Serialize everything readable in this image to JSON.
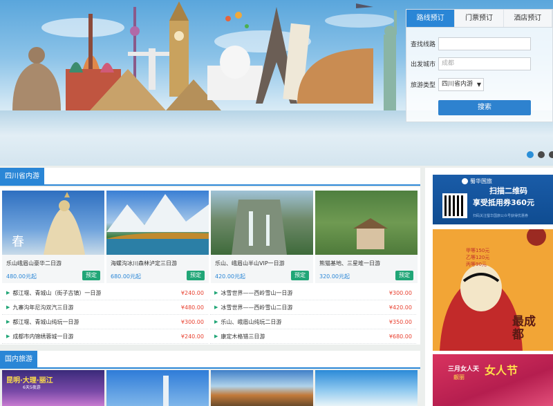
{
  "booking": {
    "tabs": [
      "路线预订",
      "门票预订",
      "酒店预订"
    ],
    "active_tab": 0,
    "route_label": "查找线路",
    "route_placeholder": "",
    "city_label": "出发城市",
    "city_placeholder": "成都",
    "type_label": "旅游类型",
    "type_value": "四川省内游",
    "search_label": "搜索"
  },
  "carousel": {
    "dot_count": 3,
    "active_dot": 0
  },
  "sections": [
    {
      "title": "四川省内游",
      "cards": [
        {
          "name": "乐山峨眉山豪华二日游",
          "price": "480.00元起",
          "book": "预定",
          "image_text": "春"
        },
        {
          "name": "海螺沟冰川森林泸定三日游",
          "price": "680.00元起",
          "book": "预定"
        },
        {
          "name": "乐山、峨眉山半山VIP一日游",
          "price": "420.00元起",
          "book": "预定"
        },
        {
          "name": "熊猫基地、三星堆一日游",
          "price": "320.00元起",
          "book": "预定"
        }
      ],
      "routes_left": [
        {
          "name": "都江堰、青城山（街子古镇）一日游",
          "price": "¥240.00"
        },
        {
          "name": "九寨沟年尼沟双汽三日游",
          "price": "¥480.00"
        },
        {
          "name": "都江堰、青城山纯玩一日游",
          "price": "¥300.00"
        },
        {
          "name": "成都市内锦绣蓉城一日游",
          "price": "¥240.00"
        }
      ],
      "routes_right": [
        {
          "name": "冰雪世界——西岭雪山一日游",
          "price": "¥300.00"
        },
        {
          "name": "冰雪世界——西岭雪山二日游",
          "price": "¥420.00"
        },
        {
          "name": "乐山、峨眉山纯玩二日游",
          "price": "¥350.00"
        },
        {
          "name": "康定木格错三日游",
          "price": "¥680.00"
        }
      ]
    },
    {
      "title": "国内旅游",
      "card_texts": [
        "昆明·大理·丽江",
        "6天5夜游"
      ]
    }
  ],
  "ads": {
    "ad1": {
      "brand": "蜀华国旅",
      "line1": "扫描二维码",
      "line2": "享受抵用券360元",
      "small": "扫码关注蜀华国旅公众号获得优惠券"
    },
    "ad2": {
      "line1": "甲等150元",
      "line2": "乙等120元",
      "line3": "丙等90元",
      "big": "最成都"
    },
    "ad3": {
      "text1": "三月女人天",
      "text2": "靓丽",
      "text3": "女人节"
    }
  },
  "colors": {
    "accent": "#2a86d6",
    "book_green": "#21a677",
    "price_red": "#e8402f"
  }
}
